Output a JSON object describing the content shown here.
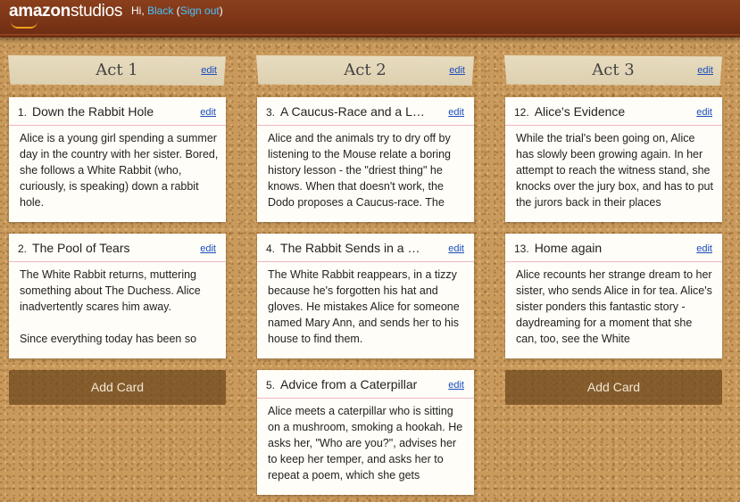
{
  "header": {
    "logo_bold": "amazon",
    "logo_rest": "studios",
    "greeting_prefix": "Hi, ",
    "user_name": "Black",
    "sign_out_open": " (",
    "sign_out": "Sign out",
    "sign_out_close": ")"
  },
  "columns": [
    {
      "title": "Act 1",
      "edit": "edit",
      "add_card": "Add Card",
      "cards": [
        {
          "num": "1.",
          "title": "Down the Rabbit Hole",
          "edit": "edit",
          "text": "Alice is a young girl spending a summer day in the country with her sister. Bored, she follows a White Rabbit (who, curiously, is speaking) down a rabbit hole."
        },
        {
          "num": "2.",
          "title": "The Pool of Tears",
          "edit": "edit",
          "text": "The White Rabbit returns, muttering something about The Duchess. Alice inadvertently scares him away.\n\nSince everything today has been so"
        }
      ]
    },
    {
      "title": "Act 2",
      "edit": "edit",
      "cards": [
        {
          "num": "3.",
          "title": "A Caucus-Race and a Lon...",
          "edit": "edit",
          "text": "Alice and the animals try to dry off by listening to the Mouse relate a boring history lesson - the \"driest thing\" he knows. When that doesn't work, the Dodo proposes a Caucus-race. The"
        },
        {
          "num": "4.",
          "title": "The Rabbit Sends in a Littl...",
          "edit": "edit",
          "text": "The White Rabbit reappears, in a tizzy because he's forgotten his hat and gloves. He mistakes Alice for someone named Mary Ann, and sends her to his house to find them."
        },
        {
          "num": "5.",
          "title": "Advice from a Caterpillar",
          "edit": "edit",
          "text": "Alice meets a caterpillar who is sitting on a mushroom, smoking a hookah. He asks her, \"Who are you?\", advises her to keep her temper, and asks her to repeat a poem, which she gets"
        }
      ]
    },
    {
      "title": "Act 3",
      "edit": "edit",
      "add_card": "Add Card",
      "cards": [
        {
          "num": "12.",
          "title": "Alice's Evidence",
          "edit": "edit",
          "text": "While the trial's been going on, Alice has slowly been growing again. In her attempt to reach the witness stand, she knocks over the jury box, and has to put the jurors back in their places"
        },
        {
          "num": "13.",
          "title": "Home again",
          "edit": "edit",
          "text": "Alice recounts her strange dream to her sister, who sends Alice in for tea. Alice's sister ponders this fantastic story - daydreaming for a moment that she can, too, see the White"
        }
      ]
    }
  ]
}
